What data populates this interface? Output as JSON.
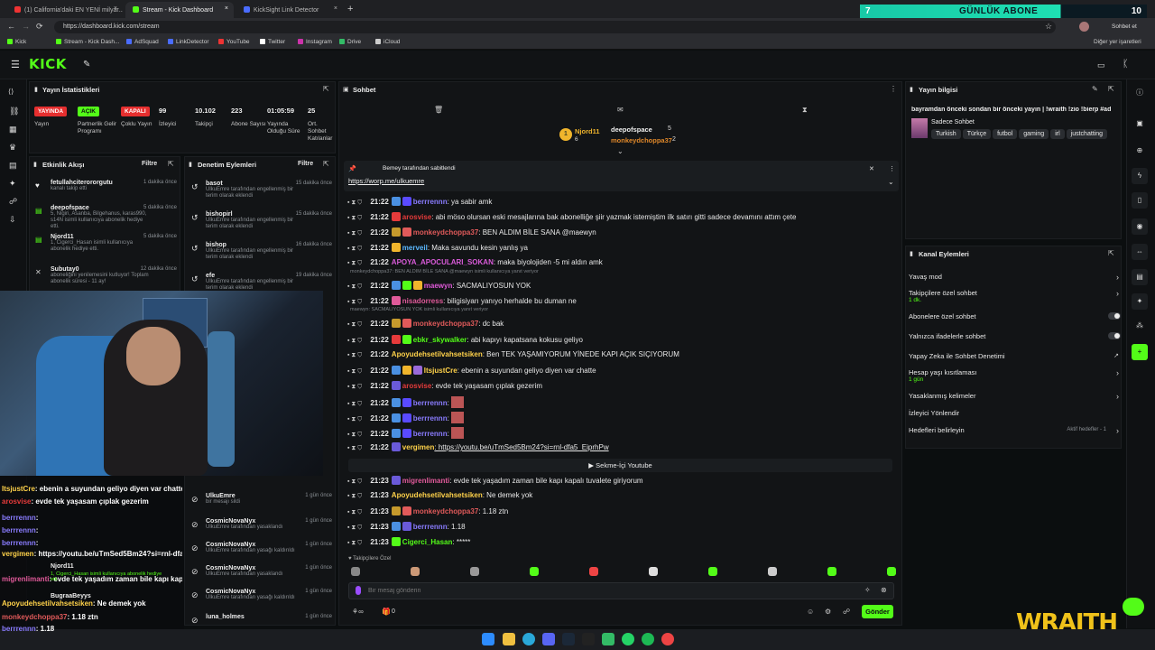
{
  "browser": {
    "tabs": [
      {
        "label": "(1) California'daki EN YENİ milyar...",
        "active": false,
        "color": "#e33"
      },
      {
        "label": "Stream - Kick Dashboard",
        "active": true,
        "color": "#53fc18"
      },
      {
        "label": "KickSight Link Detector",
        "active": false,
        "color": "#4a6cff"
      }
    ],
    "url": "https://dashboard.kick.com/stream",
    "bookmarks": [
      "Kick",
      "Stream - Kick Dash...",
      "AdSquad",
      "LinkDetector",
      "YouTube",
      "Twitter",
      "Instagram",
      "Drive",
      "iCloud"
    ],
    "other_bookmarks": "Diğer yer işaretleri",
    "profile_label": "Sohbet et",
    "sub_banner": {
      "count_left": "7",
      "label": "GÜNLÜK ABONE",
      "count_right": "10"
    }
  },
  "stats": {
    "title": "Yayın İstatistikleri",
    "items": [
      {
        "value": "YAYINDA",
        "label": "Yayın",
        "color": "#e62f2f"
      },
      {
        "value": "AÇIK",
        "label": "Partnerlik Gelir Programı",
        "color": "#53fc18"
      },
      {
        "value": "KAPALI",
        "label": "Çoklu Yayın",
        "color": "#e62f2f"
      },
      {
        "value": "99",
        "label": "İzleyici"
      },
      {
        "value": "10.102",
        "label": "Takipçi"
      },
      {
        "value": "223",
        "label": "Abone Sayısı"
      },
      {
        "value": "01:05:59",
        "label": "Yayında Olduğu Süre"
      },
      {
        "value": "25",
        "label": "Ort. Sohbet Katılanlar"
      }
    ]
  },
  "activity": {
    "title": "Etkinlik Akışı",
    "filter": "Filtre",
    "events": [
      {
        "name": "fetullahciterororgutu",
        "desc": "kanalı takip etti",
        "when": "1 dakika önce"
      },
      {
        "name": "deepofspace",
        "desc": "5, Nigiri, Asanba, Bilgehanus, karas990, s14N isimli kullanıcıya abonelik hediye etti.",
        "when": "5 dakika önce"
      },
      {
        "name": "Njord11",
        "desc": "1, Cigerci_Hasan isimli kullanıcıya abonelik hediye etti.",
        "when": "5 dakika önce"
      },
      {
        "name": "Subutay0",
        "desc": "aboneliğini yenilemesini kutluyor! Toplam abonelik süresi - 11 ay!",
        "when": "12 dakika önce"
      }
    ]
  },
  "moderation": {
    "title": "Denetim Eylemleri",
    "filter": "Filtre",
    "actions": [
      {
        "name": "basot",
        "desc": "UlkuEmre tarafından engellenmiş bir terim olarak eklendi",
        "when": "15 dakika önce"
      },
      {
        "name": "bishopirl",
        "desc": "UlkuEmre tarafından engellenmiş bir terim olarak eklendi",
        "when": "15 dakika önce"
      },
      {
        "name": "bishop",
        "desc": "UlkuEmre tarafından engellenmiş bir terim olarak eklendi",
        "when": "16 dakika önce"
      },
      {
        "name": "efe",
        "desc": "UlkuEmre tarafından engellenmiş bir terim olarak eklendi",
        "when": "19 dakika önce"
      },
      {
        "name": "UlkuEmre",
        "desc": "bir mesajı sildi",
        "when": "1 gün önce"
      },
      {
        "name": "CosmicNovaNyx",
        "desc": "UlkuEmre tarafından yasaklandı",
        "when": "1 gün önce"
      },
      {
        "name": "CosmicNovaNyx",
        "desc": "UlkuEmre tarafından yasağı kaldırıldı",
        "when": "1 gün önce"
      },
      {
        "name": "CosmicNovaNyx",
        "desc": "UlkuEmre tarafından yasaklandı",
        "when": "1 gün önce"
      },
      {
        "name": "CosmicNovaNyx",
        "desc": "UlkuEmre tarafından yasağı kaldırıldı",
        "when": "1 gün önce"
      },
      {
        "name": "luna_holmes",
        "desc": "",
        "when": "1 gün önce"
      }
    ]
  },
  "chat": {
    "title": "Sohbet",
    "top_gifters": [
      {
        "rank": "1",
        "name": "Njord11",
        "count": "6"
      },
      {
        "rank": "",
        "name": "deepofspace",
        "count": "5"
      },
      {
        "rank": "",
        "name": "monkeydchoppa37",
        "count": "2"
      }
    ],
    "pinned": {
      "by": "Bemey tarafından sabitlendi",
      "link": "https://worp.me/ulkuemre"
    },
    "messages": [
      {
        "time": "21:22",
        "user": "berrrennn",
        "color": "#8a7cff",
        "text": ": ya sabir amk"
      },
      {
        "time": "21:22",
        "user": "arosvise",
        "color": "#e63b3b",
        "text": ": abi möso olursan eski mesajlarına bak abonelliğe şiir yazmak istemiştim ilk satırı gitti sadece devamını attım çete"
      },
      {
        "time": "21:22",
        "user": "monkeydchoppa37",
        "color": "#e05a5a",
        "text": ": BEN ALDIM BİLE SANA @maewyn"
      },
      {
        "time": "21:22",
        "user": "merveil",
        "color": "#5bb8ff",
        "text": ": Maka savundu kesin yanlış ya"
      },
      {
        "time": "21:22",
        "user": "APOYA_APOCULARI_SOKAN",
        "color": "#d95bd9",
        "text": ": maka biyolojiden -5 mi aldın amk"
      },
      {
        "time": "21:22",
        "user": "maewyn",
        "color": "#e05ad9",
        "text": ": SACMALIYOSUN YOK",
        "reply": "monkeydchoppa37: BEN ALDIM BİLE SANA @maewyn isimli kullanıcıya yanıt veriyor"
      },
      {
        "time": "21:22",
        "user": "nisadorress",
        "color": "#e05a9a",
        "text": ": biligisiyarı yanıyo herhalde bu duman ne"
      },
      {
        "time": "21:22",
        "user": "monkeydchoppa37",
        "color": "#e05a5a",
        "text": ": dc bak",
        "reply": "maewyn: SACMALIYOSUN YOK isimli kullanıcıya yanıt veriyor"
      },
      {
        "time": "21:22",
        "user": "ebkr_skywalker",
        "color": "#53fc18",
        "text": ": abi kapıyı kapatsana kokusu geliyo"
      },
      {
        "time": "21:22",
        "user": "Apoyudehsetilvahsetsiken",
        "color": "#ffd24a",
        "text": ": Ben TEK YAŞAMIYORUM YİNEDE KAPI AÇIK SIÇIYORUM"
      },
      {
        "time": "21:22",
        "user": "ItsjustCre",
        "color": "#ffd24a",
        "text": ": ebenin a suyundan geliyo diyen var chatte"
      },
      {
        "time": "21:22",
        "user": "arosvise",
        "color": "#e63b3b",
        "text": ": evde tek yaşasam çıplak gezerim"
      },
      {
        "time": "21:22",
        "user": "berrrennn",
        "color": "#8a7cff",
        "text": ":"
      },
      {
        "time": "21:22",
        "user": "berrrennn",
        "color": "#8a7cff",
        "text": ":"
      },
      {
        "time": "21:22",
        "user": "berrrennn",
        "color": "#8a7cff",
        "text": ":"
      },
      {
        "time": "21:22",
        "user": "vergimen",
        "color": "#ffd24a",
        "text": ": https://youtu.be/uTmSed5Bm24?si=rnl-dfa5_EiprhPw"
      },
      {
        "time": "21:23",
        "user": "migrenlimanti",
        "color": "#e05a9a",
        "text": ": evde tek yaşadım zaman bile kapı kapalı tuvalete giriyorum"
      },
      {
        "time": "21:23",
        "user": "Apoyudehsetilvahsetsiken",
        "color": "#ffd24a",
        "text": ": Ne demek yok"
      },
      {
        "time": "21:23",
        "user": "monkeydchoppa37",
        "color": "#e05a5a",
        "text": ": 1.18 ztn"
      },
      {
        "time": "21:23",
        "user": "berrrennn",
        "color": "#8a7cff",
        "text": ": 1.18"
      },
      {
        "time": "21:23",
        "user": "Cigerci_Hasan",
        "color": "#53fc18",
        "text": ": *****"
      }
    ],
    "youtube_button": "Sekme-İçi Youtube",
    "subs_only_label": "Takipçilere Özel",
    "input_placeholder": "Bir mesaj gönderin",
    "points": "0",
    "send": "Gönder"
  },
  "stream_info": {
    "title": "Yayın bilgisi",
    "stream_title": "bayramdan önceki sondan bir önceki yayın | !wraith !zio !bierp #ad",
    "category": "Sadece Sohbet",
    "tags": [
      "Turkish",
      "Türkçe",
      "futbol",
      "gaming",
      "irl",
      "justchatting"
    ]
  },
  "channel_actions": {
    "title": "Kanal Eylemleri",
    "items": [
      {
        "label": "Yavaş mod",
        "type": "chevron"
      },
      {
        "label": "Takipçilere özel sohbet",
        "sub": "1 dk.",
        "type": "chevron"
      },
      {
        "label": "Abonelere özel sohbet",
        "type": "toggle"
      },
      {
        "label": "Yalnızca ifadelerle sohbet",
        "type": "toggle"
      },
      {
        "label": "Yapay Zeka ile Sohbet Denetimi",
        "type": "external"
      },
      {
        "label": "Hesap yaşı kısıtlaması",
        "sub": "1 gün",
        "type": "chevron"
      },
      {
        "label": "Yasaklanmış kelimeler",
        "type": "chevron"
      },
      {
        "label": "İzleyici Yönlendir",
        "type": "none"
      },
      {
        "label": "Hedefleri belirleyin",
        "extra": "Aktif hedefler - 1",
        "type": "chevron"
      }
    ]
  },
  "overlay_chat": [
    {
      "user": "ItsjustCre",
      "color": "#ffd24a",
      "text": ": ebenin a suyundan geliyo diyen var chatte"
    },
    {
      "user": "arosvise",
      "color": "#e63b3b",
      "text": ": evde tek yaşasam çıplak gezerim"
    },
    {
      "user": "berrrennn",
      "color": "#8a7cff",
      "text": ":"
    },
    {
      "user": "berrrennn",
      "color": "#8a7cff",
      "text": ":"
    },
    {
      "user": "berrrennn",
      "color": "#8a7cff",
      "text": ":"
    },
    {
      "user": "vergimen",
      "color": "#ffd24a",
      "text": ": https://youtu.be/uTmSed5Bm24?si=rnl-dfa5_EiprhPw"
    },
    {
      "user": "migrenlimanti",
      "color": "#e05a9a",
      "text": ": evde tek yaşadım zaman bile kapı kapalı tuvalete giriyorum"
    },
    {
      "user": "Apoyudehsetilvahsetsiken",
      "color": "#ffd24a",
      "text": ": Ne demek yok"
    },
    {
      "user": "monkeydchoppa37",
      "color": "#e05a5a",
      "text": ": 1.18 ztn"
    },
    {
      "user": "berrrennn",
      "color": "#8a7cff",
      "text": ": 1.18"
    },
    {
      "user": "Cigerci_Hasan",
      "color": "#53fc18",
      "text": ": *****"
    }
  ],
  "overlay_activity": [
    {
      "name": "Njord11",
      "desc": "1, Cigerci_Hasan isimli kullanıcıya abonelik hediye etti."
    },
    {
      "name": "BugraaBeyys",
      "desc": ""
    }
  ],
  "webcam_brand": "WRAITH",
  "colors": {
    "accent": "#53fc18",
    "live": "#e62f2f",
    "bg": "#0b0e0f",
    "panel": "#121416"
  }
}
